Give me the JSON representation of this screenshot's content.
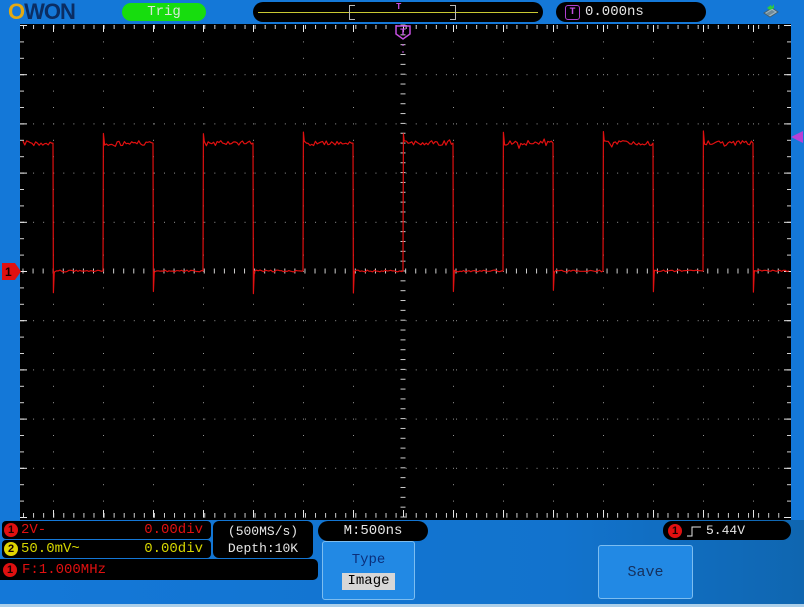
{
  "header": {
    "logo_o": "O",
    "logo_won": "WON",
    "trig_label": "Trig",
    "window_marker": "T",
    "trigger_time_icon": "T",
    "trigger_time": "0.000ns"
  },
  "plot": {
    "trigger_marker": "T",
    "channel_marker": "1"
  },
  "status": {
    "ch1": {
      "badge": "1",
      "scale": "2V-",
      "position": "0.00div"
    },
    "ch2": {
      "badge": "2",
      "scale": "50.0mV~",
      "position": "0.00div"
    },
    "sample_rate": "(500MS/s)",
    "depth": "Depth:10K",
    "timebase": "M:500ns",
    "trigger": {
      "badge": "1",
      "level": "5.44V"
    },
    "frequency": {
      "badge": "1",
      "text": "F:1.000MHz"
    }
  },
  "menu": {
    "type_label": "Type",
    "type_value": "Image",
    "save_label": "Save"
  },
  "colors": {
    "background_blue": "#1478d8",
    "trig_green": "#17dd0e",
    "waveform_red": "#e01010",
    "ch2_yellow": "#d6d600",
    "trigger_purple": "#b83fd6",
    "grid_gray": "#969696",
    "text_white": "#e6e6e6"
  },
  "chart_data": {
    "type": "line",
    "signal": "square-wave",
    "channel": "CH1",
    "frequency": "1.000MHz",
    "period_divisions": 2,
    "duty_cycle": 0.5,
    "high_level_divisions": 2.6,
    "low_level_divisions": 0,
    "volts_per_division": "2V",
    "seconds_per_division": "500ns",
    "high_level_volts": 5.2,
    "low_level_volts": 0,
    "trigger_level_volts": 5.44,
    "trigger_position": "0.000ns",
    "visible_cycles": 7.7,
    "grid": "10x15 divisions, dotted",
    "color": "#e01010"
  }
}
